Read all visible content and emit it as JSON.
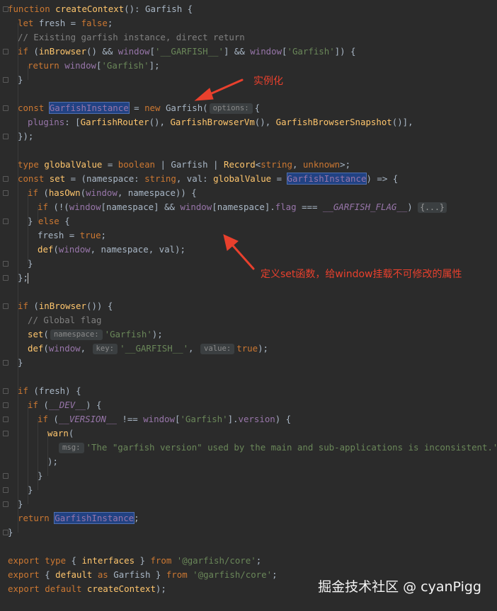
{
  "code": {
    "keywords": {
      "function": "function",
      "let": "let",
      "false": "false",
      "if": "if",
      "return": "return",
      "const": "const",
      "new": "new",
      "type": "type",
      "boolean": "boolean",
      "string": "string",
      "unknown": "unknown",
      "else": "else",
      "true": "true",
      "export": "export",
      "default": "default",
      "as": "as",
      "from": "from"
    },
    "identifiers": {
      "createContext": "createContext",
      "Garfish": "Garfish",
      "fresh": "fresh",
      "inBrowser": "inBrowser",
      "window": "window",
      "GarfishInstance": "GarfishInstance",
      "plugins": "plugins",
      "GarfishRouter": "GarfishRouter",
      "GarfishBrowserVm": "GarfishBrowserVm",
      "GarfishBrowserSnapshot": "GarfishBrowserSnapshot",
      "globalValue": "globalValue",
      "Record": "Record",
      "set": "set",
      "namespace": "namespace",
      "val": "val",
      "hasOwn": "hasOwn",
      "flag": "flag",
      "GARFISH_FLAG": "__GARFISH_FLAG__",
      "def": "def",
      "DEV": "__DEV__",
      "VERSION": "__VERSION__",
      "version": "version",
      "warn": "warn",
      "interfaces": "interfaces",
      "default_id": "default"
    },
    "strings": {
      "garfish_global": "'__GARFISH__'",
      "garfish_key": "'Garfish'",
      "core": "'@garfish/core'",
      "warn_msg": "'The \"garfish version\" used by the main and sub-applications is inconsistent.'"
    },
    "comments": {
      "c1": "// Existing garfish instance, direct return",
      "c2": "// Global flag"
    },
    "hints": {
      "options": "options:",
      "namespace": "namespace:",
      "key": "key:",
      "value": "value:",
      "msg": "msg:"
    },
    "fold_placeholder": "{...}",
    "punct": {
      "sig_tail": "(): ",
      "sp_open": " {",
      "eq": " = ",
      "semi": ";",
      "open_p": " (",
      "call_open": "() && ",
      "bracket_open": "[",
      "bracket_close": "]",
      "and": " && ",
      "close_if": "]) {",
      "close_br": "}",
      "new_open": "(",
      "brace_open": "{",
      "colon": ": [",
      "call_comma": "(), ",
      "plug_close": "()],",
      "close_obj": "});",
      "pipe": " | ",
      "lt": "<",
      "comma": ", ",
      "gt": ">;",
      "arrow_open": " = (",
      "colon_sp": ": ",
      "arrow": ") => {",
      "hasown_open": " (",
      "open": "(",
      "comma_sp": ", ",
      "close_cb": ")) {",
      "not_open": " (!(",
      "dot": ".",
      "teq": " === ",
      "close_fold": ") ",
      "close_else": "} ",
      "close_call": ");",
      "close_semi": "};",
      "inbr": "()) {",
      "paren_close": ")",
      "dev_close": ") {",
      "neq": " !== ",
      "ver_close": "].",
      "ver_tail": ") {",
      "comma_end": ",",
      "lbrace": "{ ",
      "rbrace": " }",
      "export_def_close": "();"
    }
  },
  "annotations": {
    "instantiate": "实例化",
    "define_set": "定义set函数，给window挂载不可修改的属性"
  },
  "watermark": "掘金技术社区 @ cyanPigg"
}
